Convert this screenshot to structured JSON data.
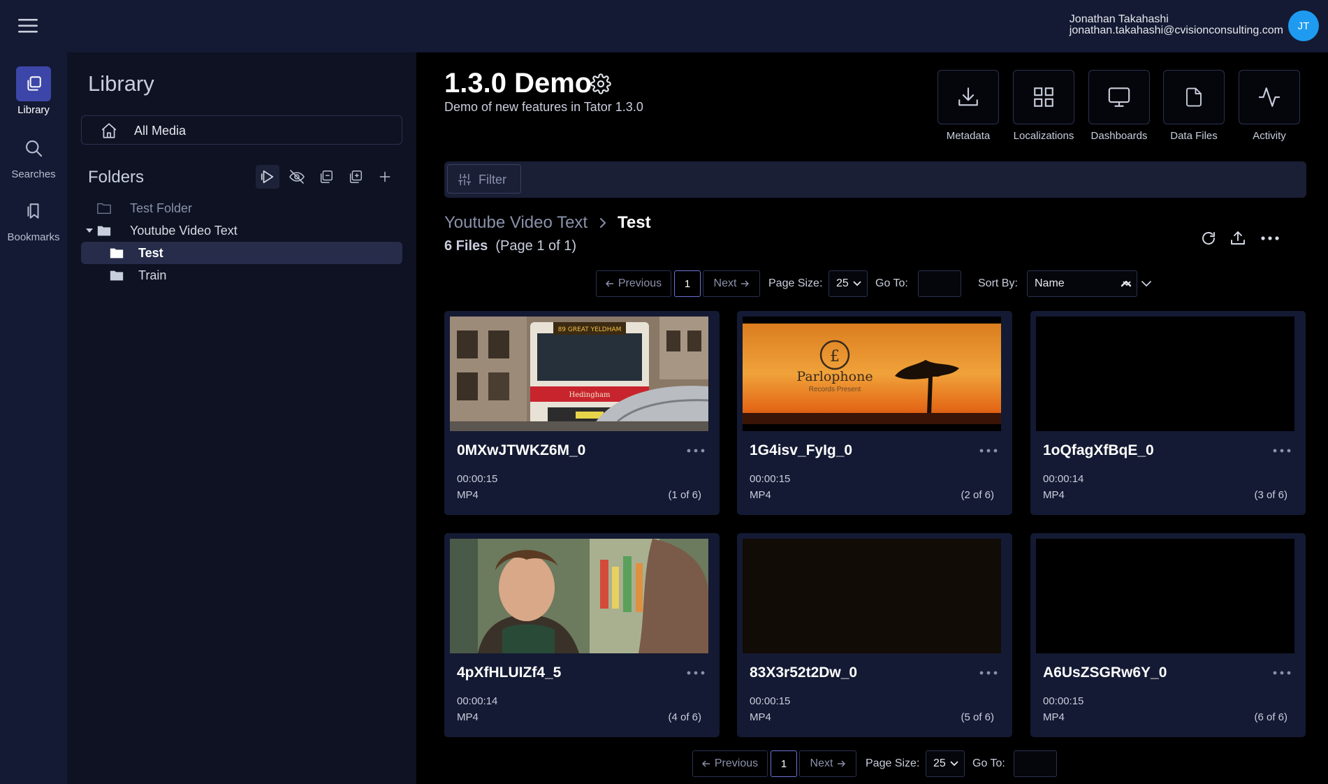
{
  "user": {
    "name": "Jonathan Takahashi",
    "email": "jonathan.takahashi@cvisionconsulting.com",
    "initials": "JT"
  },
  "rail": [
    {
      "label": "Library",
      "icon": "library-icon",
      "active": true
    },
    {
      "label": "Searches",
      "icon": "search-icon",
      "active": false
    },
    {
      "label": "Bookmarks",
      "icon": "bookmark-icon",
      "active": false
    }
  ],
  "library": {
    "title": "Library",
    "all_media": "All Media",
    "folders_title": "Folders",
    "tree": [
      {
        "label": "Test Folder",
        "level": 0,
        "expanded": false,
        "selected": false,
        "dim": true
      },
      {
        "label": "Youtube Video Text",
        "level": 0,
        "expanded": true,
        "selected": false,
        "dim": false
      },
      {
        "label": "Test",
        "level": 1,
        "selected": true,
        "dim": false
      },
      {
        "label": "Train",
        "level": 1,
        "selected": false,
        "dim": false
      }
    ]
  },
  "project": {
    "title": "1.3.0 Demo",
    "description": "Demo of new features in Tator 1.3.0",
    "actions": [
      {
        "label": "Metadata",
        "icon": "download-icon"
      },
      {
        "label": "Localizations",
        "icon": "grid-icon"
      },
      {
        "label": "Dashboards",
        "icon": "monitor-icon"
      },
      {
        "label": "Data Files",
        "icon": "file-icon"
      },
      {
        "label": "Activity",
        "icon": "activity-icon"
      }
    ]
  },
  "filter": {
    "label": "Filter"
  },
  "breadcrumb": {
    "parent": "Youtube Video Text",
    "current": "Test"
  },
  "file_count": {
    "count": "6 Files",
    "page": "(Page 1 of 1)"
  },
  "pagination": {
    "previous": "Previous",
    "next": "Next",
    "page": "1",
    "page_size_label": "Page Size:",
    "page_size": "25",
    "goto_label": "Go To:",
    "sort_label": "Sort By:",
    "sort_value": "Name"
  },
  "cards": [
    {
      "name": "0MXwJTWKZ6M_0",
      "duration": "00:00:15",
      "type": "MP4",
      "position": "(1 of 6)",
      "thumb": "bus"
    },
    {
      "name": "1G4isv_FyIg_0",
      "duration": "00:00:15",
      "type": "MP4",
      "position": "(2 of 6)",
      "thumb": "parlophone",
      "thumb_title": "Parlophone",
      "thumb_sub": "Records Present"
    },
    {
      "name": "1oQfagXfBqE_0",
      "duration": "00:00:14",
      "type": "MP4",
      "position": "(3 of 6)",
      "thumb": "black"
    },
    {
      "name": "4pXfHLUIZf4_5",
      "duration": "00:00:14",
      "type": "MP4",
      "position": "(4 of 6)",
      "thumb": "person"
    },
    {
      "name": "83X3r52t2Dw_0",
      "duration": "00:00:15",
      "type": "MP4",
      "position": "(5 of 6)",
      "thumb": "dark"
    },
    {
      "name": "A6UsZSGRw6Y_0",
      "duration": "00:00:15",
      "type": "MP4",
      "position": "(6 of 6)",
      "thumb": "black"
    }
  ],
  "colors": {
    "accent": "#3c46a8",
    "avatar": "#1e9bf0",
    "panel": "#141a33",
    "selected": "#262c4a"
  }
}
